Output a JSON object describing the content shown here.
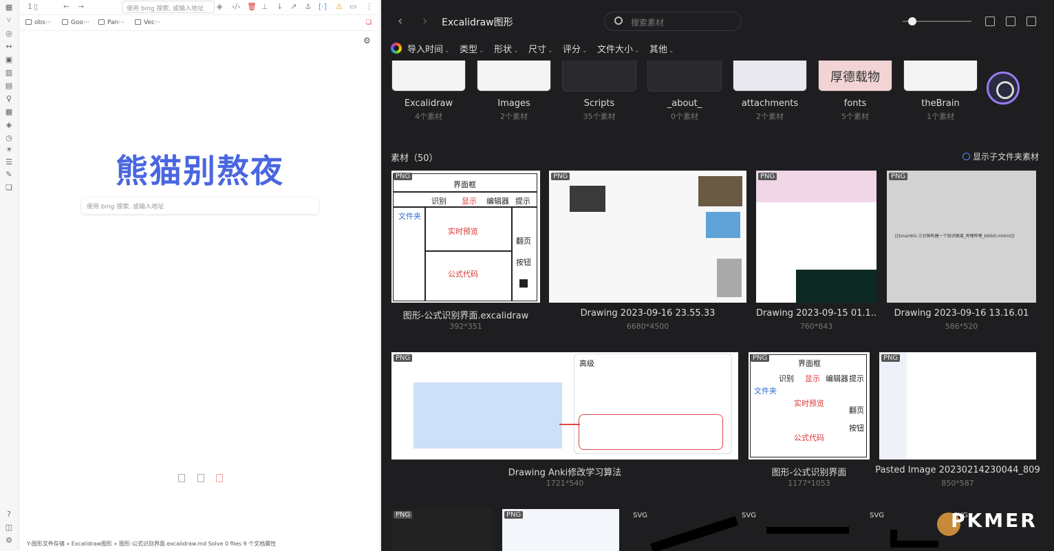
{
  "left": {
    "tab_num": "1",
    "url_placeholder": "使用 bing 搜索, 或输入地址",
    "bookmarks": [
      "obs···",
      "Goo···",
      "Pan···",
      "Vec···"
    ],
    "big_title": "熊猫别熬夜",
    "search_placeholder": "使用 bing 搜索, 或输入地址",
    "status": "Y-图形文件存储 » Excalidraw图形 » 图形-公式识别界面.excalidraw.md Solve   0 files  9 个文档属性"
  },
  "right": {
    "title": "Excalidraw图形",
    "search_placeholder": "搜索素材",
    "filters": [
      "导入时间",
      "类型",
      "形状",
      "尺寸",
      "评分",
      "文件大小",
      "其他"
    ],
    "folders": [
      {
        "name": "Excalidraw",
        "count": "4个素材"
      },
      {
        "name": "Images",
        "count": "2个素材"
      },
      {
        "name": "Scripts",
        "count": "35个素材"
      },
      {
        "name": "_about_",
        "count": "0个素材"
      },
      {
        "name": "attachments",
        "count": "2个素材"
      },
      {
        "name": "fonts",
        "count": "5个素材"
      },
      {
        "name": "theBrain",
        "count": "1个素材"
      }
    ],
    "fonts_thumb_text": "厚德载物",
    "section_title": "素材（50）",
    "show_subfolder": "显示子文件夹素材",
    "cards": [
      {
        "badge": "PNG",
        "name": "图形-公式识别界面.excalidraw",
        "size": "392*351"
      },
      {
        "badge": "PNG",
        "name": "Drawing 2023-09-16 23.55.33",
        "size": "6680*4500"
      },
      {
        "badge": "PNG",
        "name": "Drawing 2023-09-15 01.1..",
        "size": "760*843"
      },
      {
        "badge": "PNG",
        "name": "Drawing 2023-09-16 13.16.01",
        "size": "586*520"
      },
      {
        "badge": "PNG",
        "name": "Drawing Anki修改学习算法",
        "size": "1721*540"
      },
      {
        "badge": "PNG",
        "name": "图形-公式识别界面",
        "size": "1177*1053"
      },
      {
        "badge": "PNG",
        "name": "Pasted Image 20230214230044_809",
        "size": "850*587"
      }
    ],
    "bottom_badges": [
      "PNG",
      "PNG",
      "SVG",
      "SVG",
      "SVG",
      "SVG"
    ],
    "sketch": {
      "title": "界面框",
      "recog": "识别",
      "show": "显示",
      "editor": "编辑器",
      "hint": "提示",
      "folder": "文件夹",
      "preview": "实时预览",
      "flip": "翻页",
      "button": "按钮",
      "code": "公式代码"
    },
    "anki_panel_title": "高级",
    "smartkg_text": "[[SmartKG-三分钟构建一个知识图谱_哔哩哔哩_bilibili.mhtml]]",
    "pkmer": "PKMER"
  }
}
